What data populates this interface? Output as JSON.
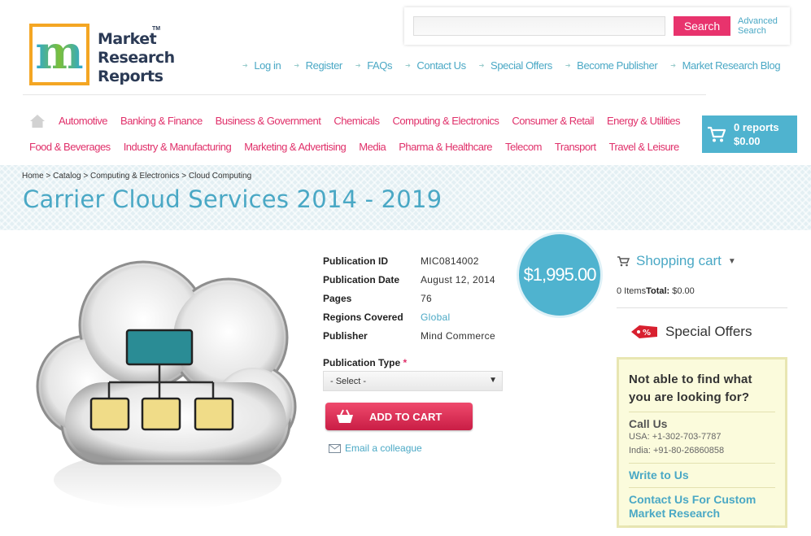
{
  "logo": {
    "line1": "Market",
    "line2": "Research",
    "line3": "Reports",
    "tm": "TM"
  },
  "search": {
    "placeholder": "",
    "button": "Search",
    "advanced": "Advanced Search"
  },
  "toplinks": [
    "Log in",
    "Register",
    "FAQs",
    "Contact Us",
    "Special Offers",
    "Become Publisher",
    "Market Research Blog"
  ],
  "categories_row1": [
    "Automotive",
    "Banking & Finance",
    "Business & Government",
    "Chemicals",
    "Computing & Electronics",
    "Consumer & Retail",
    "Energy & Utilities"
  ],
  "categories_row2": [
    "Food & Beverages",
    "Industry & Manufacturing",
    "Marketing & Advertising",
    "Media",
    "Pharma & Healthcare",
    "Telecom",
    "Transport",
    "Travel & Leisure"
  ],
  "cart": {
    "reports": "0 reports",
    "total": "$0.00"
  },
  "breadcrumb": [
    "Home",
    "Catalog",
    "Computing & Electronics",
    "Cloud Computing"
  ],
  "page_title": "Carrier Cloud Services 2014 - 2019",
  "details": [
    {
      "label": "Publication ID",
      "value": "MIC0814002"
    },
    {
      "label": "Publication Date",
      "value": "August 12, 2014"
    },
    {
      "label": "Pages",
      "value": "76"
    },
    {
      "label": "Regions Covered",
      "value": "Global"
    },
    {
      "label": "Publisher",
      "value": "Mind Commerce"
    }
  ],
  "publication_type": {
    "label": "Publication Type",
    "required": "*",
    "selected": "- Select -"
  },
  "add_to_cart": "ADD TO CART",
  "email_colleague": "Email a colleague",
  "price": "$1,995.00",
  "shopping_cart": {
    "title": "Shopping cart",
    "items": "0 Items",
    "total_label": "Total:",
    "total": "$0.00"
  },
  "special_offers": "Special Offers",
  "help": {
    "question": "Not able to find what you are looking for?",
    "call_us": "Call Us",
    "usa": "USA: +1-302-703-7787",
    "india": "India: +91-80-26860858",
    "write": "Write to Us",
    "custom": "Contact Us For Custom Market Research"
  },
  "colors": {
    "accent_blue": "#4aa8c5",
    "accent_pink": "#e0306a",
    "cart_blue": "#4fb3cf",
    "logo_orange": "#f4a623"
  },
  "icons": [
    "home-icon",
    "cart-icon",
    "envelope-icon",
    "tag-icon",
    "shopping-cart-icon"
  ]
}
